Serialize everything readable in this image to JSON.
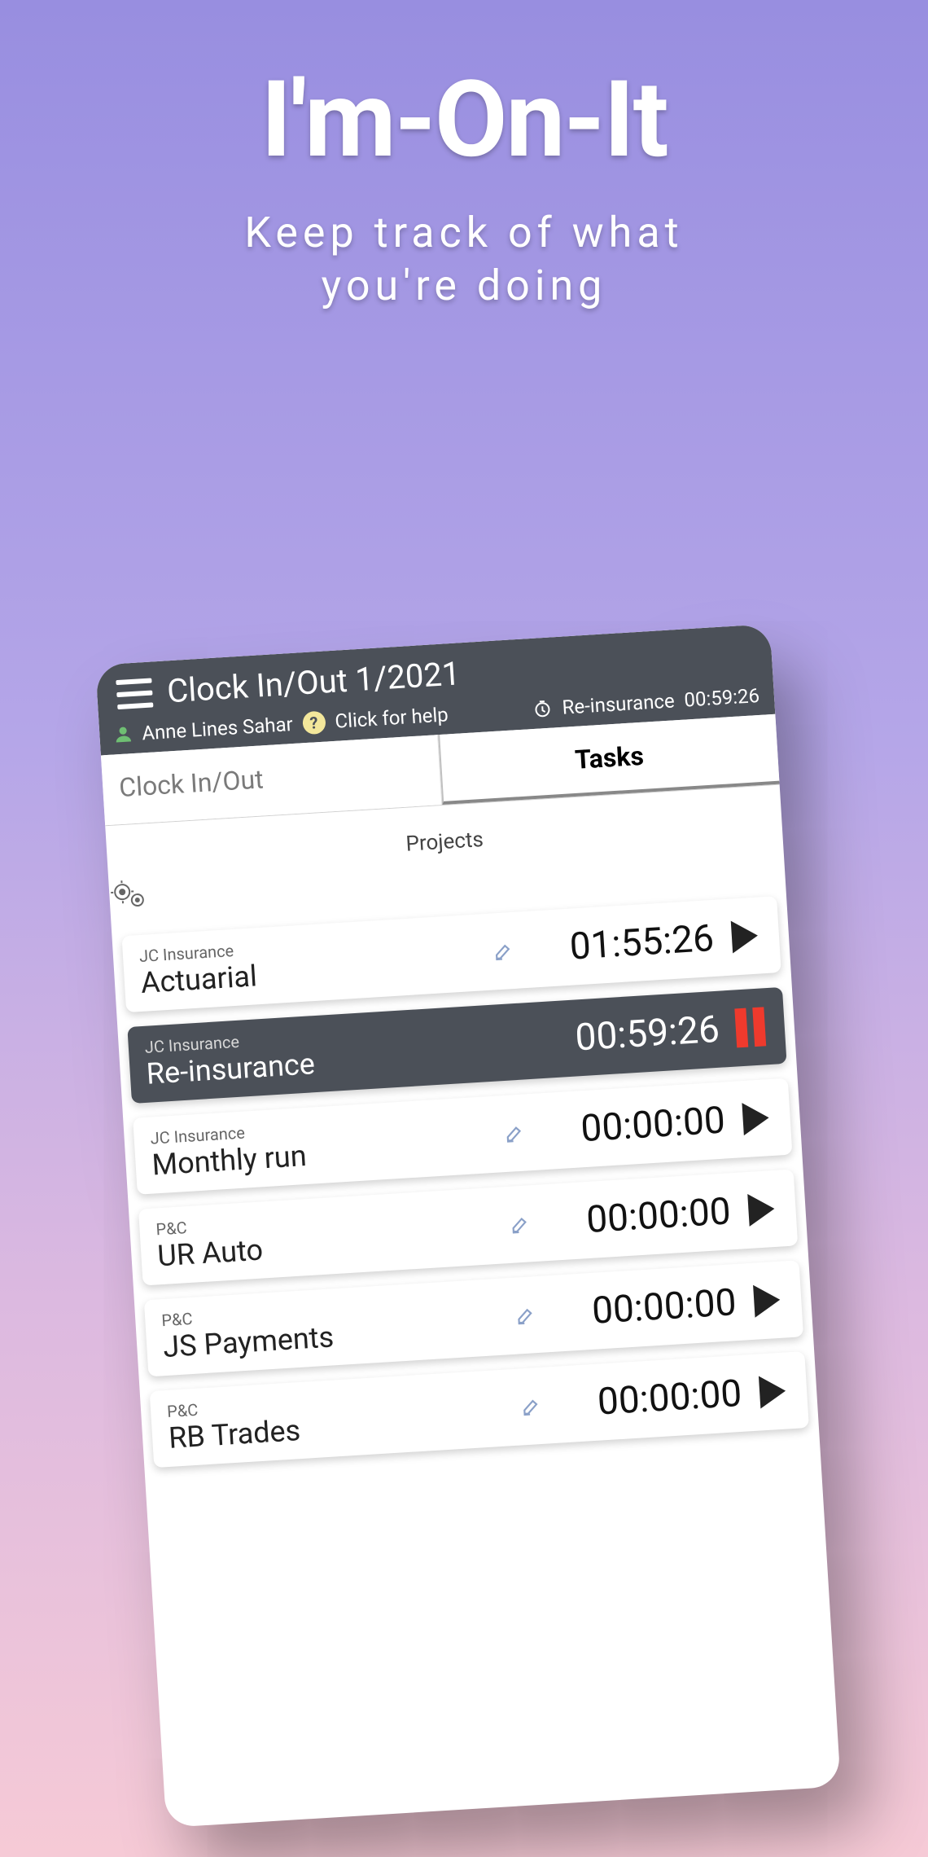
{
  "hero": {
    "title": "I'm-On-It",
    "subtitle_line1": "Keep track of what",
    "subtitle_line2": "you're doing"
  },
  "header": {
    "title": "Clock In/Out 1/2021",
    "user_name": "Anne Lines Sahar",
    "help_label": "Click for help",
    "help_badge": "?",
    "running_task": "Re-insurance",
    "running_time": "00:59:26"
  },
  "tabs": {
    "clock": "Clock In/Out",
    "tasks": "Tasks"
  },
  "projects_header": "Projects",
  "tasks": [
    {
      "project": "JC Insurance",
      "name": "Actuarial",
      "time": "01:55:26",
      "state": "idle"
    },
    {
      "project": "JC Insurance",
      "name": "Re-insurance",
      "time": "00:59:26",
      "state": "running"
    },
    {
      "project": "JC Insurance",
      "name": "Monthly run",
      "time": "00:00:00",
      "state": "idle"
    },
    {
      "project": "P&C",
      "name": "UR Auto",
      "time": "00:00:00",
      "state": "idle"
    },
    {
      "project": "P&C",
      "name": "JS Payments",
      "time": "00:00:00",
      "state": "idle"
    },
    {
      "project": "P&C",
      "name": "RB Trades",
      "time": "00:00:00",
      "state": "idle"
    }
  ]
}
